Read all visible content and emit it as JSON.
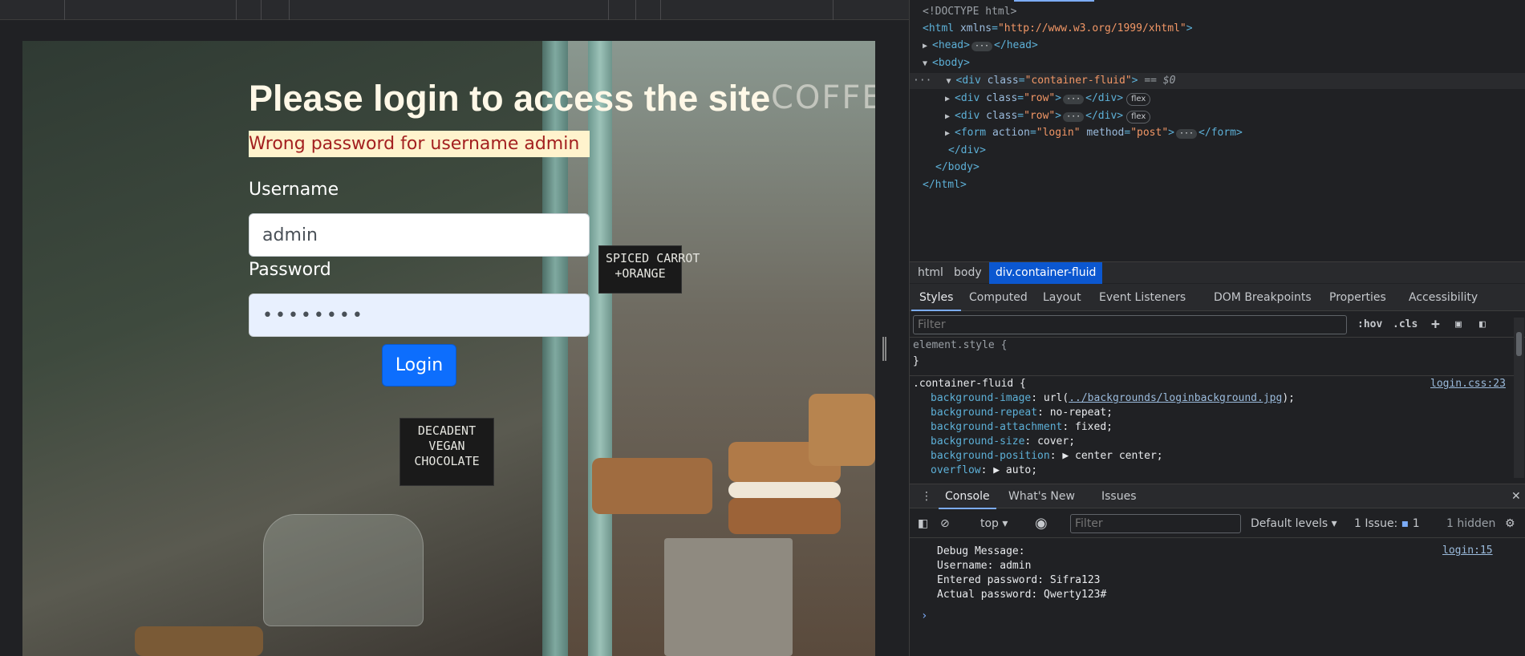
{
  "viewport": {
    "heading": "Please login to access the site",
    "error_message": "Wrong password for username admin",
    "username_label": "Username",
    "username_value": "admin",
    "password_label": "Password",
    "password_value": "••••••••",
    "login_button": "Login",
    "signs": {
      "coffee": "COFFEE",
      "spiced": "SPICED CARROT\n+ORANGE",
      "vegan": "DECADENT\nVEGAN\nCHOCOLATE"
    }
  },
  "devtools": {
    "elements": {
      "doctype": "<!DOCTYPE html>",
      "html_open_tag": "html",
      "html_attr_name": "xmlns",
      "html_attr_value": "\"http://www.w3.org/1999/xhtml\"",
      "head": "head",
      "body": "body",
      "container_tag": "div",
      "container_class": "\"container-fluid\"",
      "selected_marker": "== $0",
      "row_class": "\"row\"",
      "flex_badge": "flex",
      "form_action": "\"login\"",
      "form_method": "\"post\"",
      "form_tag": "form"
    },
    "breadcrumbs": [
      "html",
      "body",
      "div.container-fluid"
    ],
    "tabs": [
      "Styles",
      "Computed",
      "Layout",
      "Event Listeners",
      "DOM Breakpoints",
      "Properties",
      "Accessibility"
    ],
    "styles": {
      "filter_placeholder": "Filter",
      "hov": ":hov",
      "cls": ".cls",
      "element_style": "element.style {",
      "close_brace": "}",
      "rule_selector": ".container-fluid {",
      "source": "login.css:23",
      "properties": [
        {
          "name": "background-image",
          "value": "url(",
          "link": "../backgrounds/loginbackground.jpg",
          "tail": ");"
        },
        {
          "name": "background-repeat",
          "value": "no-repeat;"
        },
        {
          "name": "background-attachment",
          "value": "fixed;"
        },
        {
          "name": "background-size",
          "value": "cover;"
        },
        {
          "name": "background-position",
          "value": "▶ center center;"
        },
        {
          "name": "overflow",
          "value": "▶ auto;"
        }
      ]
    },
    "console": {
      "tabs": [
        "Console",
        "What's New",
        "Issues"
      ],
      "context": "top",
      "filter_placeholder": "Filter",
      "levels": "Default levels",
      "issues": "1 Issue:",
      "issues_count": "1",
      "hidden": "1 hidden",
      "source": "login:15",
      "messages": [
        "Debug Message:",
        "Username: admin",
        "Entered password: Sifra123",
        "Actual password: Qwerty123#"
      ]
    }
  }
}
